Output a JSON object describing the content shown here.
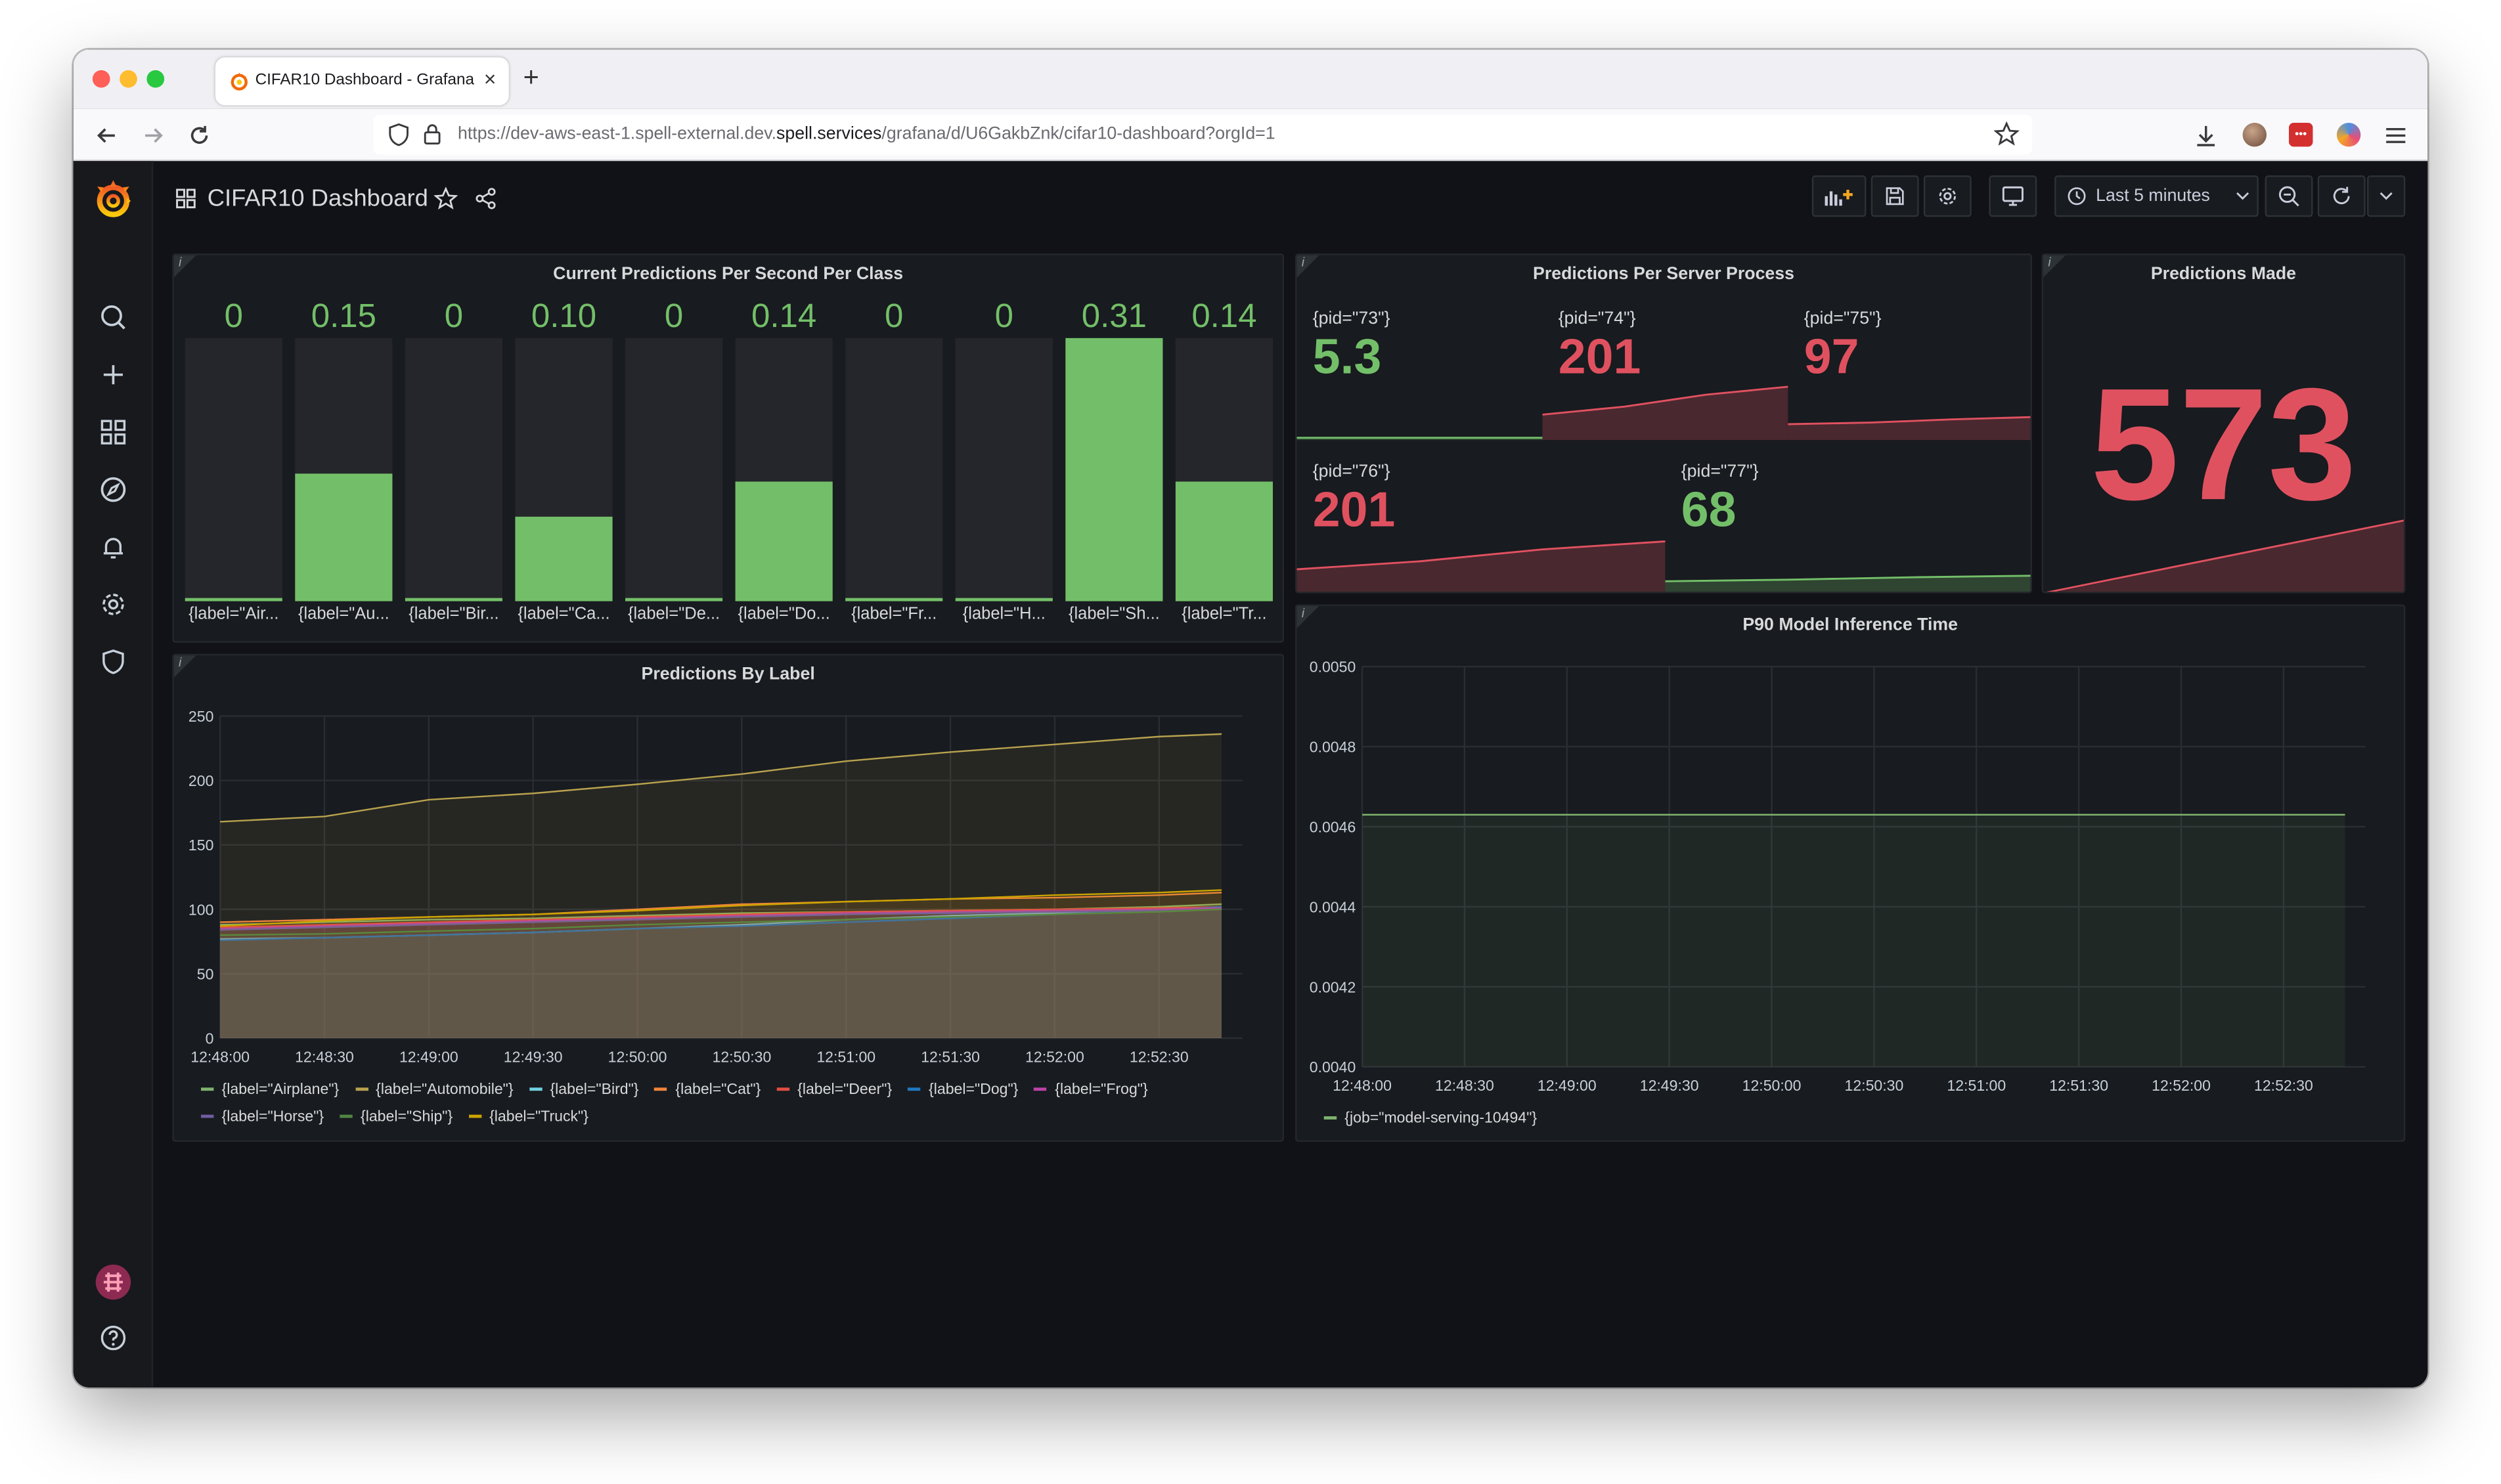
{
  "browser": {
    "tab_title": "CIFAR10 Dashboard - Grafana",
    "url_prefix": "https://dev-aws-east-1.spell-external.dev.",
    "url_domain": "spell.services",
    "url_path": "/grafana/d/U6GakbZnk/cifar10-dashboard?orgId=1"
  },
  "dashboard": {
    "title": "CIFAR10 Dashboard",
    "time_range_label": "Last 5 minutes"
  },
  "colors": {
    "green": "#73bf69",
    "red": "#e05160",
    "panel_bg": "#181b1f",
    "page_bg": "#111217"
  },
  "panels": {
    "bargauge": {
      "title": "Current Predictions Per Second Per Class",
      "bars": [
        {
          "label": "{label=\"Air...",
          "value_text": "0",
          "value": 0
        },
        {
          "label": "{label=\"Au...",
          "value_text": "0.15",
          "value": 0.15
        },
        {
          "label": "{label=\"Bir...",
          "value_text": "0",
          "value": 0
        },
        {
          "label": "{label=\"Ca...",
          "value_text": "0.10",
          "value": 0.1
        },
        {
          "label": "{label=\"De...",
          "value_text": "0",
          "value": 0
        },
        {
          "label": "{label=\"Do...",
          "value_text": "0.14",
          "value": 0.14
        },
        {
          "label": "{label=\"Fr...",
          "value_text": "0",
          "value": 0
        },
        {
          "label": "{label=\"H...",
          "value_text": "0",
          "value": 0
        },
        {
          "label": "{label=\"Sh...",
          "value_text": "0.31",
          "value": 0.31
        },
        {
          "label": "{label=\"Tr...",
          "value_text": "0.14",
          "value": 0.14
        }
      ]
    },
    "server": {
      "title": "Predictions Per Server Process",
      "stats": [
        {
          "label": "{pid=\"73\"}",
          "value": "5.3",
          "level": "ok",
          "spark": [
            0.01,
            0.01,
            0.01,
            0.01
          ]
        },
        {
          "label": "{pid=\"74\"}",
          "value": "201",
          "level": "high",
          "spark": [
            0.3,
            0.4,
            0.55,
            0.65
          ]
        },
        {
          "label": "{pid=\"75\"}",
          "value": "97",
          "level": "high",
          "spark": [
            0.18,
            0.2,
            0.24,
            0.27
          ]
        },
        {
          "label": "{pid=\"76\"}",
          "value": "201",
          "level": "high",
          "spark": [
            0.3,
            0.4,
            0.55,
            0.65
          ]
        },
        {
          "label": "{pid=\"77\"}",
          "value": "68",
          "level": "ok",
          "spark": [
            0.15,
            0.17,
            0.2,
            0.22
          ]
        }
      ]
    },
    "total": {
      "title": "Predictions Made",
      "value": "573"
    },
    "by_label": {
      "title": "Predictions By Label",
      "chart_data": {
        "type": "area",
        "x": [
          "12:48:00",
          "12:48:30",
          "12:49:00",
          "12:49:30",
          "12:50:00",
          "12:50:30",
          "12:51:00",
          "12:51:30",
          "12:52:00",
          "12:52:30",
          "12:52:48"
        ],
        "xticks": [
          "12:48:00",
          "12:48:30",
          "12:49:00",
          "12:49:30",
          "12:50:00",
          "12:50:30",
          "12:51:00",
          "12:51:30",
          "12:52:00",
          "12:52:30"
        ],
        "yticks": [
          "0",
          "50",
          "100",
          "150",
          "200",
          "250"
        ],
        "ylim": [
          0,
          250
        ],
        "series": [
          {
            "name": "{label=\"Airplane\"}",
            "color": "#7eb26d",
            "values": [
              88,
              90,
              92,
              93,
              95,
              97,
              98,
              99,
              100,
              102,
              104
            ]
          },
          {
            "name": "{label=\"Automobile\"}",
            "color": "#b8a24e",
            "values": [
              168,
              172,
              185,
              190,
              197,
              205,
              215,
              222,
              228,
              234,
              236
            ]
          },
          {
            "name": "{label=\"Bird\"}",
            "color": "#6ed0e0",
            "values": [
              77,
              78,
              80,
              82,
              85,
              88,
              92,
              95,
              97,
              100,
              102
            ]
          },
          {
            "name": "{label=\"Cat\"}",
            "color": "#ef843c",
            "values": [
              90,
              92,
              94,
              96,
              100,
              104,
              106,
              108,
              109,
              111,
              113
            ]
          },
          {
            "name": "{label=\"Deer\"}",
            "color": "#e24d42",
            "values": [
              86,
              88,
              90,
              92,
              94,
              96,
              98,
              99,
              100,
              101,
              102
            ]
          },
          {
            "name": "{label=\"Dog\"}",
            "color": "#1f78c1",
            "values": [
              76,
              78,
              80,
              82,
              85,
              87,
              90,
              93,
              96,
              99,
              102
            ]
          },
          {
            "name": "{label=\"Frog\"}",
            "color": "#ba43a9",
            "values": [
              85,
              87,
              89,
              91,
              93,
              95,
              97,
              98,
              99,
              100,
              101
            ]
          },
          {
            "name": "{label=\"Horse\"}",
            "color": "#705da0",
            "values": [
              84,
              86,
              88,
              90,
              92,
              94,
              96,
              97,
              98,
              99,
              100
            ]
          },
          {
            "name": "{label=\"Ship\"}",
            "color": "#508642",
            "values": [
              80,
              81,
              83,
              85,
              88,
              90,
              92,
              94,
              96,
              98,
              100
            ]
          },
          {
            "name": "{label=\"Truck\"}",
            "color": "#cca300",
            "values": [
              87,
              91,
              94,
              96,
              99,
              103,
              106,
              108,
              111,
              113,
              115
            ]
          }
        ]
      }
    },
    "p90": {
      "title": "P90 Model Inference Time",
      "chart_data": {
        "type": "area",
        "x": [
          "12:48:00",
          "12:52:48"
        ],
        "xticks": [
          "12:48:00",
          "12:48:30",
          "12:49:00",
          "12:49:30",
          "12:50:00",
          "12:50:30",
          "12:51:00",
          "12:51:30",
          "12:52:00",
          "12:52:30"
        ],
        "yticks": [
          "0.0040",
          "0.0042",
          "0.0044",
          "0.0046",
          "0.0048",
          "0.0050"
        ],
        "ylim": [
          0.004,
          0.005
        ],
        "series": [
          {
            "name": "{job=\"model-serving-10494\"}",
            "color": "#7eb26d",
            "values": [
              0.00463,
              0.00463
            ]
          }
        ]
      }
    }
  }
}
